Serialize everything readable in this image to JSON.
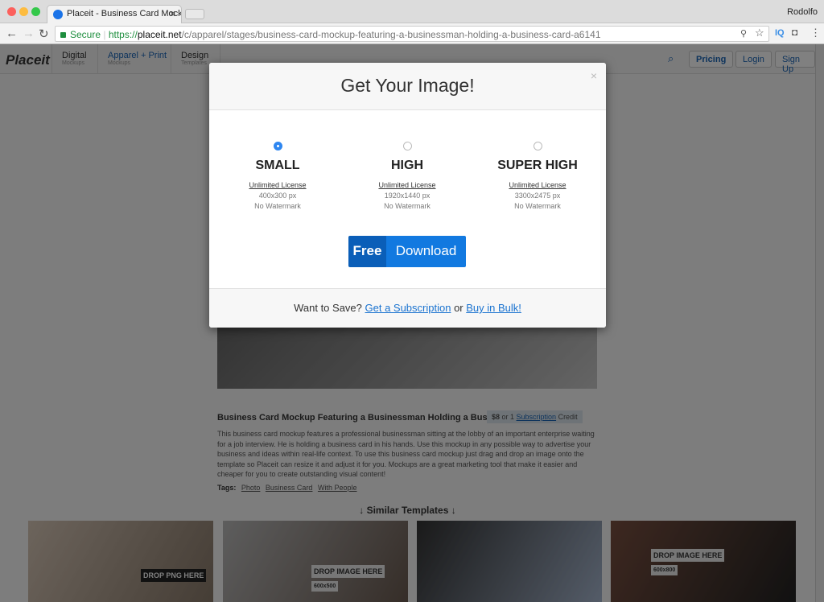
{
  "browser": {
    "tab_title": "Placeit - Business Card Mockup Featuring a Businessman",
    "user": "Rodolfo",
    "secure_label": "Secure",
    "url_scheme": "https://",
    "url_host": "placeit.net",
    "url_path": "/c/apparel/stages/business-card-mockup-featuring-a-businessman-holding-a-business-card-a6141",
    "extension_label": "IQ"
  },
  "site": {
    "logo": "Placeit",
    "nav": [
      {
        "label": "Digital",
        "sub": "Mockups"
      },
      {
        "label": "Apparel + Print",
        "sub": "Mockups"
      },
      {
        "label": "Design",
        "sub": "Templates"
      }
    ],
    "pricing": "Pricing",
    "login": "Login",
    "signup": "Sign Up",
    "product_title": "Business Card Mockup Featuring a Businessman Holding a Business Card",
    "price": "$8",
    "price_or": " or 1 ",
    "price_link": "Subscription",
    "price_credit": " Credit",
    "description": "This business card mockup features a professional businessman sitting at the lobby of an important enterprise waiting for a job interview. He is holding a business card in his hands. Use this mockup in any possible way to advertise your business and ideas within real-life context. To use this business card mockup just drag and drop an image onto the template so Placeit can resize it and adjust it for you. Mockups are a great marketing tool that make it easier and cheaper for you to create outstanding visual content!",
    "tags_label": "Tags:",
    "tags": [
      "Photo",
      "Business Card",
      "With People"
    ],
    "similar_heading": "↓ Similar Templates ↓",
    "thumbs": [
      {
        "label": "DROP PNG HERE"
      },
      {
        "label": "DROP IMAGE HERE",
        "size": "600x500"
      },
      {
        "label": ""
      },
      {
        "label": "DROP IMAGE HERE",
        "size": "600x800"
      }
    ]
  },
  "modal": {
    "title": "Get Your Image!",
    "close": "×",
    "options": [
      {
        "name": "SMALL",
        "license": "Unlimited License",
        "size": "400x300 px",
        "watermark": "No Watermark",
        "selected": true
      },
      {
        "name": "HIGH",
        "license": "Unlimited License",
        "size": "1920x1440 px",
        "watermark": "No Watermark",
        "selected": false
      },
      {
        "name": "SUPER HIGH",
        "license": "Unlimited License",
        "size": "3300x2475 px",
        "watermark": "No Watermark",
        "selected": false
      }
    ],
    "free": "Free",
    "download": "Download",
    "footer_prefix": "Want to Save? ",
    "footer_link1": "Get a Subscription",
    "footer_or": " or ",
    "footer_link2": "Buy in Bulk!"
  },
  "colors": {
    "accent": "#1279e0",
    "accent_dark": "#0a5eb8"
  }
}
